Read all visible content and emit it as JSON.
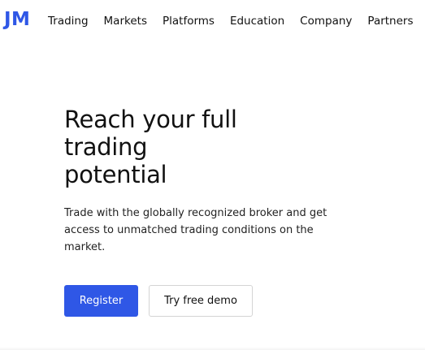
{
  "header": {
    "logo_text": "JM",
    "nav": [
      {
        "label": "Trading"
      },
      {
        "label": "Markets"
      },
      {
        "label": "Platforms"
      },
      {
        "label": "Education"
      },
      {
        "label": "Company"
      },
      {
        "label": "Partners"
      }
    ]
  },
  "hero": {
    "title_line1": "Reach your full",
    "title_line2": "trading",
    "title_line3": "potential",
    "description": "Trade with the globally recognized broker and get access to unmatched trading conditions on the market."
  },
  "cta": {
    "register_label": "Register",
    "demo_label": "Try free demo"
  },
  "colors": {
    "accent": "#2f57e6",
    "text": "#111111",
    "background": "#ffffff"
  }
}
